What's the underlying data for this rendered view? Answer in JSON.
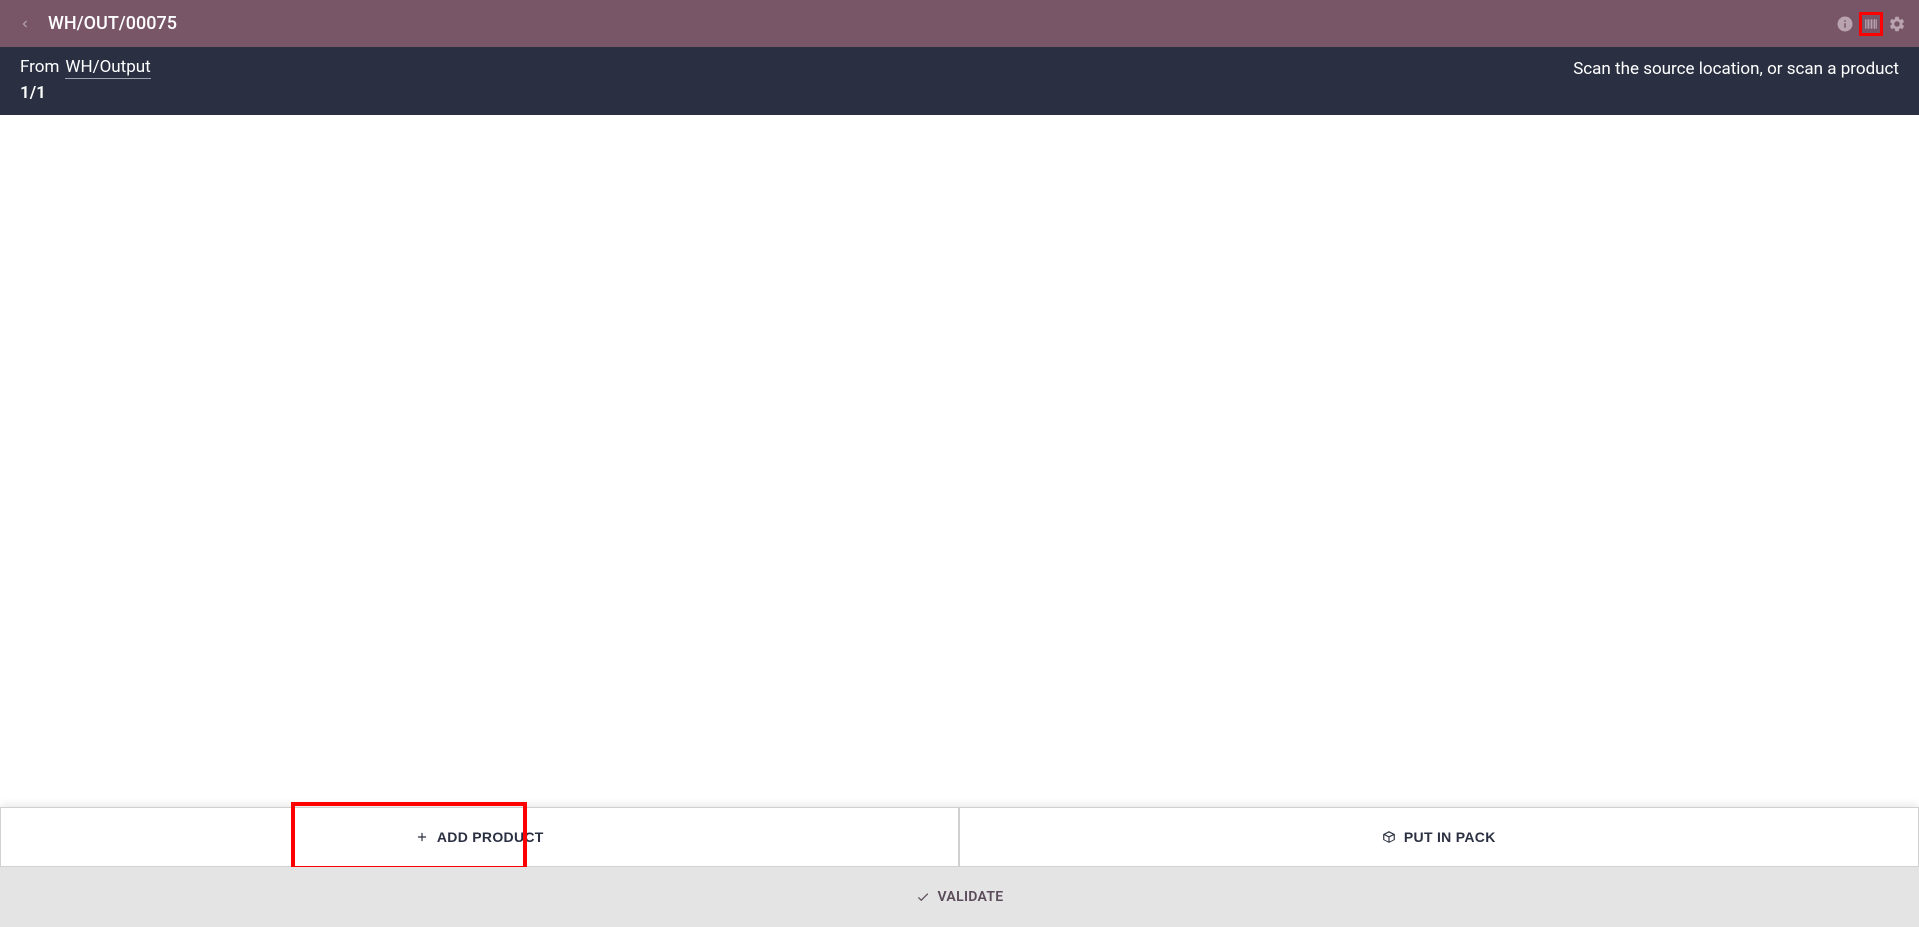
{
  "header": {
    "title": "WH/OUT/00075"
  },
  "subHeader": {
    "fromLabel": "From",
    "fromLocation": "WH/Output",
    "pageCounter": "1/1",
    "instruction": "Scan the source location, or scan a product"
  },
  "actions": {
    "addProduct": "ADD PRODUCT",
    "putInPack": "PUT IN PACK",
    "validate": "VALIDATE"
  }
}
